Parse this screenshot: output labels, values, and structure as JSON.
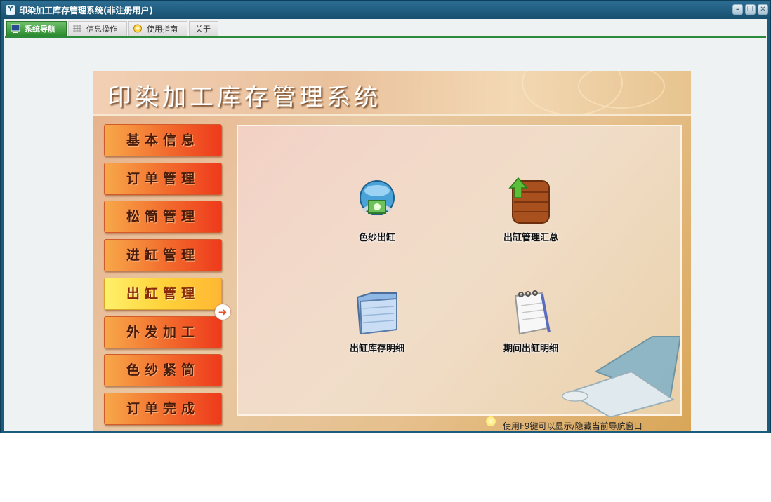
{
  "window": {
    "title": "印染加工库存管理系统(非注册用户)",
    "controls": [
      "minimize-icon",
      "restore-icon",
      "close-icon"
    ]
  },
  "toolbar": {
    "tabs": [
      {
        "label": "系统导航",
        "active": true
      },
      {
        "label": "信息操作",
        "active": false
      },
      {
        "label": "使用指南",
        "active": false
      },
      {
        "label": "关于",
        "active": false
      }
    ]
  },
  "banner": {
    "title": "印染加工库存管理系统"
  },
  "sidebar": {
    "items": [
      {
        "label": "基本信息"
      },
      {
        "label": "订单管理"
      },
      {
        "label": "松筒管理"
      },
      {
        "label": "进缸管理"
      },
      {
        "label": "出缸管理",
        "active": true
      },
      {
        "label": "外发加工"
      },
      {
        "label": "色纱紧筒"
      },
      {
        "label": "订单完成"
      }
    ]
  },
  "main": {
    "items": [
      {
        "label": "色纱出缸",
        "icon": "globe-network-icon"
      },
      {
        "label": "出缸管理汇总",
        "icon": "wooden-box-upload-icon"
      },
      {
        "label": "出缸库存明细",
        "icon": "folder-icon"
      },
      {
        "label": "期间出缸明细",
        "icon": "notepad-pen-icon"
      }
    ]
  },
  "footer": {
    "hint": "使用F9键可以显示/隐藏当前导航窗口"
  },
  "colors": {
    "title_bar": "#1b5b7d",
    "tab_active": "#2c8b2e",
    "nav_button": "#f26a2c",
    "nav_button_active": "#ffd23a"
  }
}
